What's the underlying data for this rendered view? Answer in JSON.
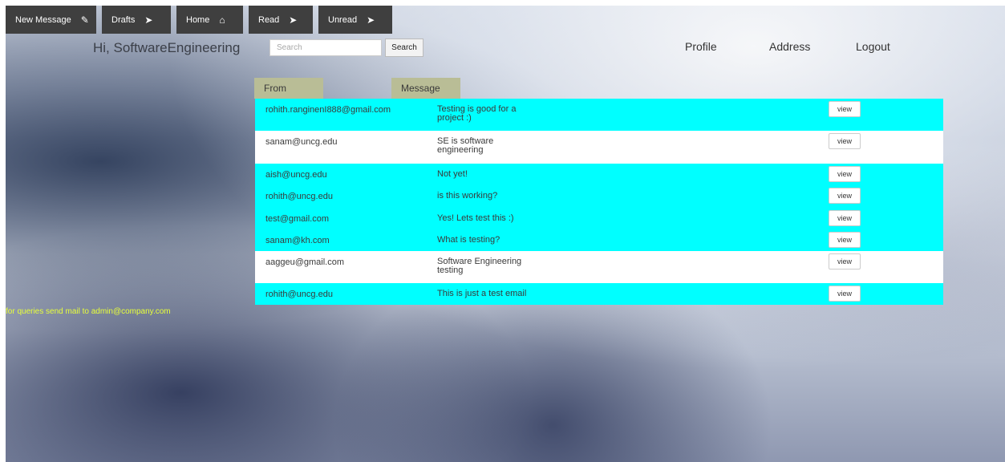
{
  "nav": {
    "items": [
      {
        "label": "New Message",
        "icon": "pencil-icon",
        "glyph": "✎"
      },
      {
        "label": "Drafts",
        "icon": "paper-plane-icon",
        "glyph": "➤"
      },
      {
        "label": "Home",
        "icon": "home-icon",
        "glyph": "⌂"
      },
      {
        "label": "Read",
        "icon": "paper-plane-icon",
        "glyph": "➤"
      },
      {
        "label": "Unread",
        "icon": "paper-plane-icon",
        "glyph": "➤"
      }
    ]
  },
  "header": {
    "greeting": "Hi, SoftwareEngineering",
    "search_placeholder": "Search",
    "search_button": "Search",
    "profile": "Profile",
    "address": "Address",
    "logout": "Logout"
  },
  "table": {
    "columns": {
      "from": "From",
      "message": "Message"
    },
    "view_label": "view",
    "rows": [
      {
        "from": "rohith.ranginenI888@gmail.com",
        "message": "Testing is good for a project :)",
        "color": "#00ffff"
      },
      {
        "from": "sanam@uncg.edu",
        "message": "SE is software engineering",
        "color": "#ffffff"
      },
      {
        "from": "aish@uncg.edu",
        "message": "Not yet!",
        "color": "#00ffff"
      },
      {
        "from": "rohith@uncg.edu",
        "message": "is this working?",
        "color": "#00ffff"
      },
      {
        "from": "test@gmail.com",
        "message": "Yes! Lets test this :)",
        "color": "#00ffff"
      },
      {
        "from": "sanam@kh.com",
        "message": "What is testing?",
        "color": "#00ffff"
      },
      {
        "from": "aaggeu@gmail.com",
        "message": "Software Engineering testing",
        "color": "#ffffff"
      },
      {
        "from": "rohith@uncg.edu",
        "message": "This is just a test email",
        "color": "#00ffff"
      }
    ]
  },
  "footer": {
    "note": "for queries send mail to admin@company.com",
    "color": "#e8ff3a"
  }
}
